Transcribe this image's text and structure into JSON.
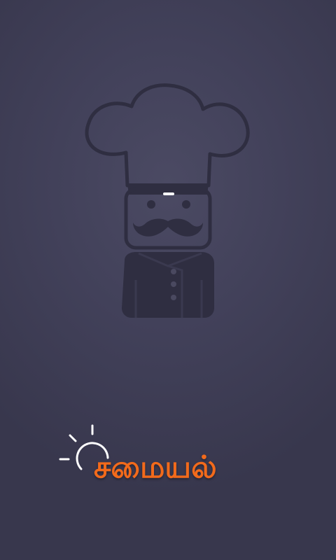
{
  "app": {
    "title": "சமையல்"
  },
  "icons": {
    "hero": "chef-icon",
    "logo_accent": "sun-icon"
  },
  "colors": {
    "background": "#42415a",
    "illustration": "#2f2e41",
    "accent": "#f26a1b",
    "logo_sun": "#ffffff"
  }
}
